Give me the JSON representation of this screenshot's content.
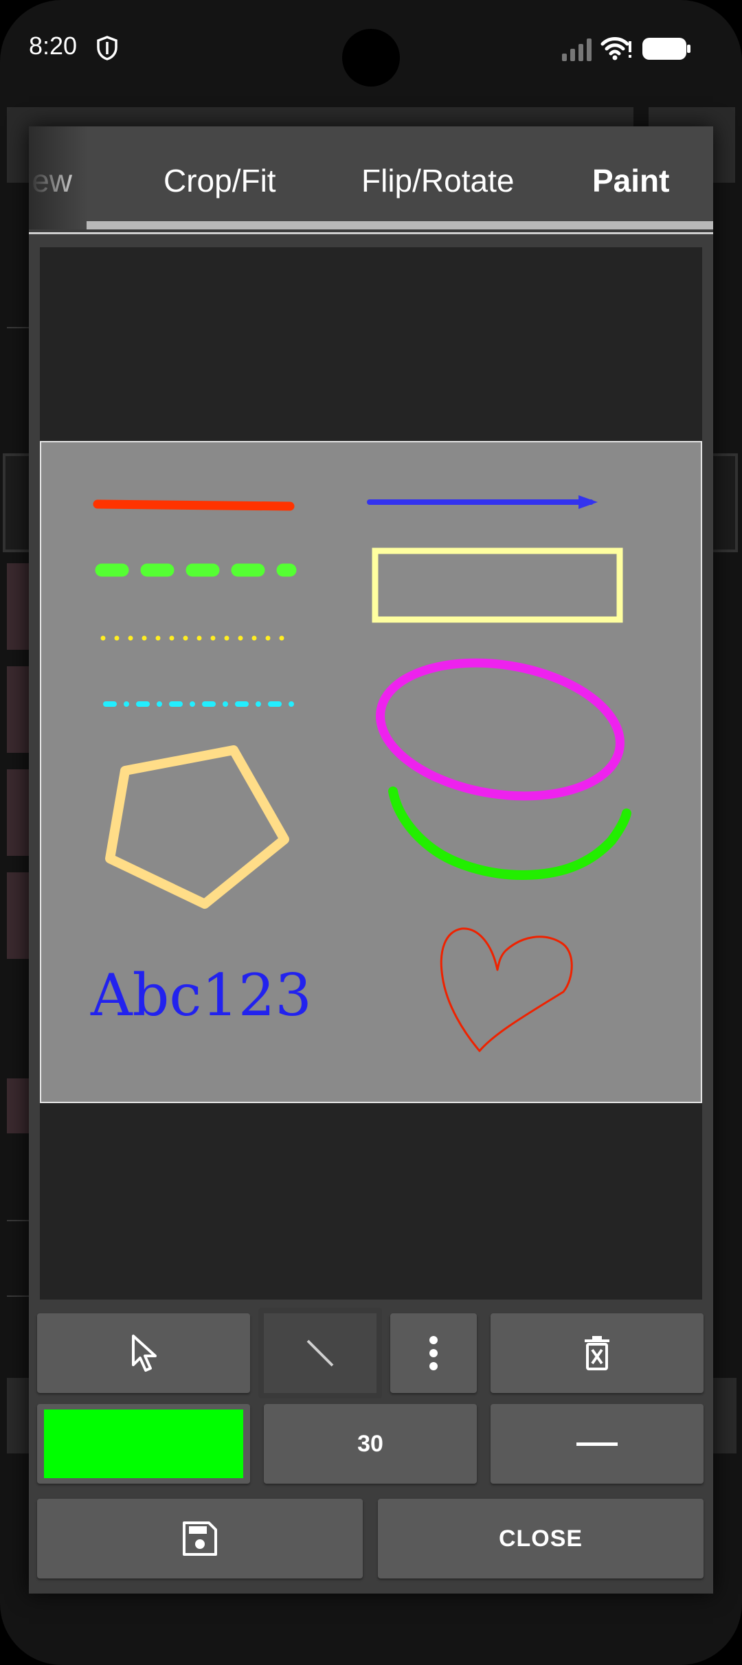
{
  "status_bar": {
    "time": "8:20"
  },
  "tabs": [
    {
      "label": "View",
      "visible_text": "iew",
      "active": false
    },
    {
      "label": "Crop/Fit",
      "active": false
    },
    {
      "label": "Flip/Rotate",
      "active": false
    },
    {
      "label": "Paint",
      "active": true
    }
  ],
  "canvas": {
    "text_annotation": "Abc123",
    "shapes": [
      {
        "type": "line",
        "style": "solid",
        "color": "#ff3300"
      },
      {
        "type": "line",
        "style": "dashed",
        "color": "#55ff33"
      },
      {
        "type": "line",
        "style": "dotted",
        "color": "#ffee22"
      },
      {
        "type": "line",
        "style": "dash-dot",
        "color": "#22eeff"
      },
      {
        "type": "polygon",
        "sides": 5,
        "color": "#ffdd88"
      },
      {
        "type": "text",
        "color": "#2222ee"
      },
      {
        "type": "arrow",
        "color": "#3333ee"
      },
      {
        "type": "rectangle",
        "color": "#ffffa0"
      },
      {
        "type": "ellipse",
        "color": "#ee22ee"
      },
      {
        "type": "freehand-curve",
        "color": "#22ee00"
      },
      {
        "type": "freehand-heart",
        "color": "#ee2200"
      }
    ]
  },
  "toolbar": {
    "row1": [
      {
        "icon": "cursor-arrow-icon",
        "selected": false
      },
      {
        "icon": "line-tool-icon",
        "selected": true
      },
      {
        "icon": "more-vertical-icon",
        "selected": false
      },
      {
        "icon": "delete-icon",
        "selected": false
      }
    ],
    "color_swatch": "#00ff00",
    "stroke_width": "30",
    "line_style_icon": "solid-line-icon"
  },
  "actions": {
    "save_icon": "save-icon",
    "close_label": "CLOSE"
  },
  "colors": {
    "dialog_bg": "#3d3d3d",
    "tab_bar_bg": "#474747",
    "button_bg": "#5a5a5a",
    "canvas_bg": "#242424",
    "image_bg": "#8a8a8a"
  }
}
